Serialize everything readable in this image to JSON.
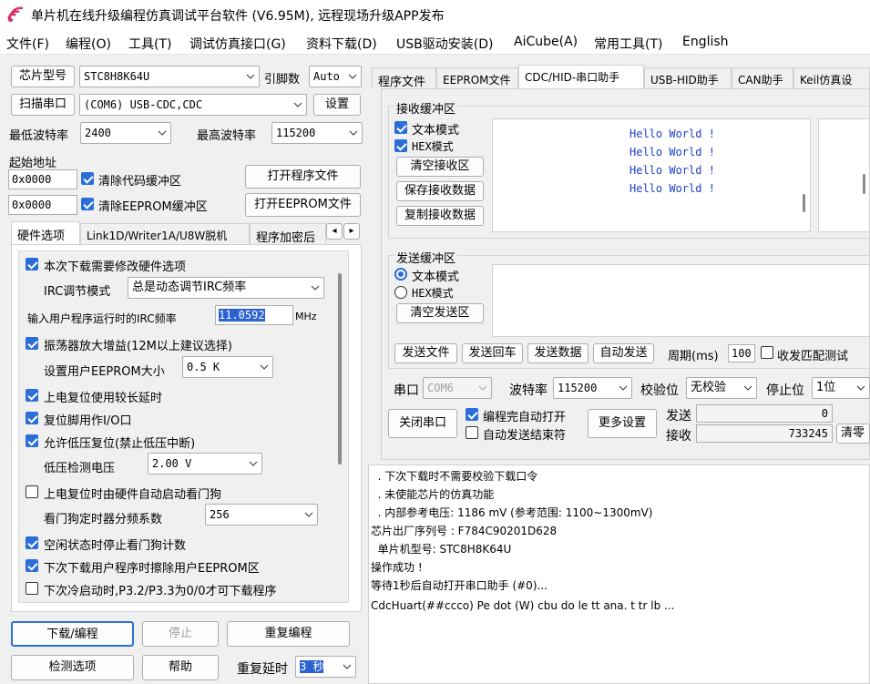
{
  "window": {
    "title": "单片机在线升级编程仿真调试平台软件 (V6.95M), 远程现场升级APP发布"
  },
  "menu": [
    "文件(F)",
    "编程(O)",
    "工具(T)",
    "调试仿真接口(G)",
    "资料下载(D)",
    "USB驱动安装(D)",
    "AiCube(A)",
    "常用工具(T)",
    "English"
  ],
  "left": {
    "chip_label": "芯片型号",
    "chip_value": "STC8H8K64U",
    "pin_label": "引脚数",
    "pin_value": "Auto",
    "scan_btn": "扫描串口",
    "port_value": "(COM6) USB-CDC,CDC",
    "settings_btn": "设置",
    "min_baud_label": "最低波特率",
    "min_baud_value": "2400",
    "max_baud_label": "最高波特率",
    "max_baud_value": "115200",
    "start_addr_label": "起始地址",
    "addr1": "0x0000",
    "clear_code_label": "清除代码缓冲区",
    "open_prog_btn": "打开程序文件",
    "addr2": "0x0000",
    "clear_eeprom_label": "清除EEPROM缓冲区",
    "open_eeprom_btn": "打开EEPROM文件",
    "tabs": [
      "硬件选项",
      "Link1D/Writer1A/U8W脱机",
      "程序加密后"
    ],
    "hw": {
      "opt1": "本次下载需要修改硬件选项",
      "irc_mode_label": "IRC调节模式",
      "irc_mode_value": "总是动态调节IRC频率",
      "irc_freq_label": "输入用户程序运行时的IRC频率",
      "irc_freq_value": "11.0592",
      "irc_freq_unit": "MHz",
      "opt2": "振荡器放大增益(12M以上建议选择)",
      "eeprom_size_label": "设置用户EEPROM大小",
      "eeprom_size_value": "0.5 K",
      "opt3": "上电复位使用较长延时",
      "opt4": "复位脚用作I/O口",
      "opt5": "允许低压复位(禁止低压中断)",
      "lvd_label": "低压检测电压",
      "lvd_value": "2.00 V",
      "opt6": "上电复位时由硬件自动启动看门狗",
      "wdt_label": "看门狗定时器分频系数",
      "wdt_value": "256",
      "opt7": "空闲状态时停止看门狗计数",
      "opt8": "下次下载用户程序时擦除用户EEPROM区",
      "opt9": "下次冷启动时,P3.2/P3.3为0/0才可下载程序"
    },
    "download_btn": "下载/编程",
    "stop_btn": "停止",
    "repeat_btn": "重复编程",
    "detect_btn": "检测选项",
    "help_btn": "帮助",
    "repeat_delay_label": "重复延时",
    "repeat_delay_value": "3 秒"
  },
  "right": {
    "tabs": [
      "程序文件",
      "EEPROM文件",
      "CDC/HID-串口助手",
      "USB-HID助手",
      "CAN助手",
      "Keil仿真设"
    ],
    "recv_group": "接收缓冲区",
    "recv_text_mode": "文本模式",
    "recv_hex_mode": "HEX模式",
    "clear_recv_btn": "清空接收区",
    "save_recv_btn": "保存接收数据",
    "copy_recv_btn": "复制接收数据",
    "recv_lines": [
      "Hello World !",
      "Hello World !",
      "Hello World !",
      "Hello World !"
    ],
    "send_group": "发送缓冲区",
    "send_text_mode": "文本模式",
    "send_hex_mode": "HEX模式",
    "clear_send_btn": "清空发送区",
    "send_file_btn": "发送文件",
    "send_echo_btn": "发送回车",
    "send_data_btn": "发送数据",
    "auto_send_btn": "自动发送",
    "period_label": "周期(ms)",
    "period_value": "100",
    "loop_test_label": "收发匹配测试",
    "port_label": "串口",
    "port_value": "COM6",
    "baud_label": "波特率",
    "baud_value": "115200",
    "parity_label": "校验位",
    "parity_value": "无校验",
    "stop_label": "停止位",
    "stop_value": "1位",
    "close_port_btn": "关闭串口",
    "auto_open_label": "编程完自动打开",
    "auto_end_label": "自动发送结束符",
    "more_settings_btn": "更多设置",
    "send_count_label": "发送",
    "send_count_value": "0",
    "recv_count_label": "接收",
    "recv_count_value": "733245",
    "clear_count_btn": "清零"
  },
  "log": [
    "  . 下次下载时不需要校验下载口令",
    "  . 未使能芯片的仿真功能",
    "  . 内部参考电压: 1186 mV (参考范围: 1100~1300mV)",
    "芯片出厂序列号 : F784C90201D628",
    "",
    "  单片机型号: STC8H8K64U",
    "",
    "操作成功 !",
    "",
    "等待1秒后自动打开串口助手 (#0)...",
    "",
    "CdcHuart(##ccco) Pe dot (W) cbu do le tt ana. t tr lb ..."
  ]
}
